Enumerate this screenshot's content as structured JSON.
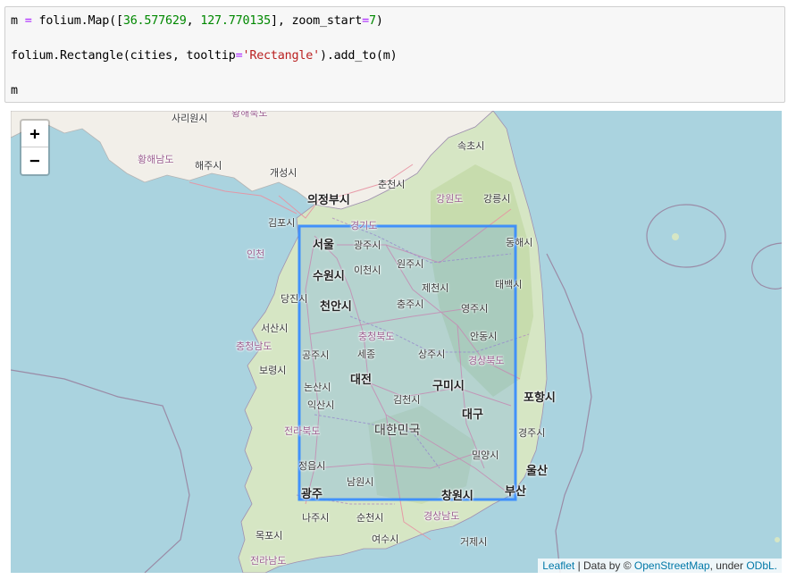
{
  "code": {
    "line1": {
      "p1": "m ",
      "p2": "=",
      "p3": " folium.Map([",
      "p4": "36.577629",
      "p5": ", ",
      "p6": "127.770135",
      "p7": "], zoom_start",
      "p8": "=",
      "p9": "7",
      "p10": ")"
    },
    "line2": {
      "p1": "folium.Rectangle(cities, tooltip",
      "p2": "=",
      "p3": "'Rectangle'",
      "p4": ").add_to(m)"
    },
    "line3": "m"
  },
  "map": {
    "zoom_in": "+",
    "zoom_out": "−",
    "labels": {
      "sariwon": "사리원시",
      "hwanghae_n": "황해북도",
      "hwanghae_s": "황해남도",
      "haeju": "해주시",
      "kaesong": "개성시",
      "sokcho": "속초시",
      "uijeongbu": "의정부시",
      "chuncheon": "춘천시",
      "gangwon": "강원도",
      "gangneung": "강릉시",
      "gimpo": "김포시",
      "gyeonggi": "경기도",
      "seoul": "서울",
      "gwangju_si": "광주시",
      "incheon": "인천",
      "donghae": "동해시",
      "wonju": "원주시",
      "suwon": "수원시",
      "icheon": "이천시",
      "jecheon": "제천시",
      "taebaek": "태백시",
      "dangjin": "당진시",
      "cheonan": "천안시",
      "chungju": "충주시",
      "yeongju": "영주시",
      "seosan": "서산시",
      "chungbuk": "충청북도",
      "andong": "안동시",
      "chungnam": "충청남도",
      "gongju": "공주시",
      "sejong": "세종",
      "sangju": "상주시",
      "gyeongbuk": "경상북도",
      "boryeong": "보령시",
      "daejeon": "대전",
      "nonsan": "논산시",
      "gumi": "구미시",
      "pohang": "포항시",
      "gimcheon": "김천시",
      "iksan": "익산시",
      "daegu": "대구",
      "jeonbuk": "전라북도",
      "korea": "대한민국",
      "gyeongju": "경주시",
      "miryang": "밀양시",
      "jeongeup": "정읍시",
      "ulsan": "울산",
      "namwon": "남원시",
      "gwangju": "광주",
      "changwon": "창원시",
      "busan": "부산",
      "naju": "나주시",
      "suncheon": "순천시",
      "gyeongnam": "경상남도",
      "geoje": "거제시",
      "mokpo": "목포시",
      "yeosu": "여수시",
      "jeonnam": "전라남도"
    },
    "attribution": {
      "leaflet": "Leaflet",
      "data_by": " | Data by © ",
      "osm": "OpenStreetMap",
      "under": ", under ",
      "odbl": "ODbL."
    },
    "colors": {
      "sea": "#aad3df",
      "land": "#f2efe9",
      "rectangle": "#3388ff",
      "road": "#e892a2"
    }
  }
}
